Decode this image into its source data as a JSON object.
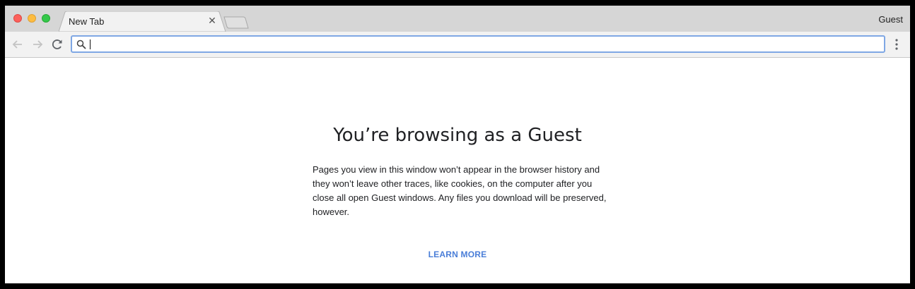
{
  "window": {
    "tab": {
      "title": "New Tab",
      "close_glyph": "✕"
    },
    "profile_label": "Guest"
  },
  "toolbar": {
    "back_icon": "arrow-left-icon",
    "forward_icon": "arrow-right-icon",
    "reload_icon": "reload-icon",
    "omnibox": {
      "value": "",
      "placeholder": "",
      "icon": "search-icon"
    },
    "menu_icon": "kebab-menu-icon"
  },
  "page": {
    "heading": "You’re browsing as a Guest",
    "body": "Pages you view in this window won’t appear in the browser history and they won’t leave other traces, like cookies, on the computer after you close all open Guest windows. Any files you download will be preserved, however.",
    "learn_more": "LEARN MORE"
  },
  "colors": {
    "link": "#4a7ed8",
    "omnibox_focus": "#7fa7e4",
    "titlebar": "#d6d6d6"
  }
}
